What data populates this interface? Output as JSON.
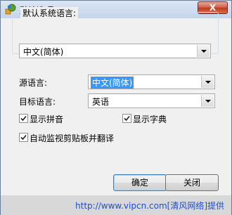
{
  "window": {
    "title": "默认选项",
    "close_label": "X"
  },
  "system_language": {
    "group_title": "默认系统语言:",
    "selected": "中文(简体)"
  },
  "source_language": {
    "label": "源语言:",
    "selected": "中文(简体)"
  },
  "target_language": {
    "label": "目标语言:",
    "selected": "英语"
  },
  "options": {
    "show_pinyin": {
      "label": "显示拼音",
      "checked": true
    },
    "show_dictionary": {
      "label": "显示字典",
      "checked": true
    },
    "auto_monitor": {
      "label": "自动监视剪贴板并翻译",
      "checked": true
    }
  },
  "buttons": {
    "ok": "确定",
    "close": "关闭"
  },
  "watermark": "http://www.vipcn.com[清风网络]提供"
}
